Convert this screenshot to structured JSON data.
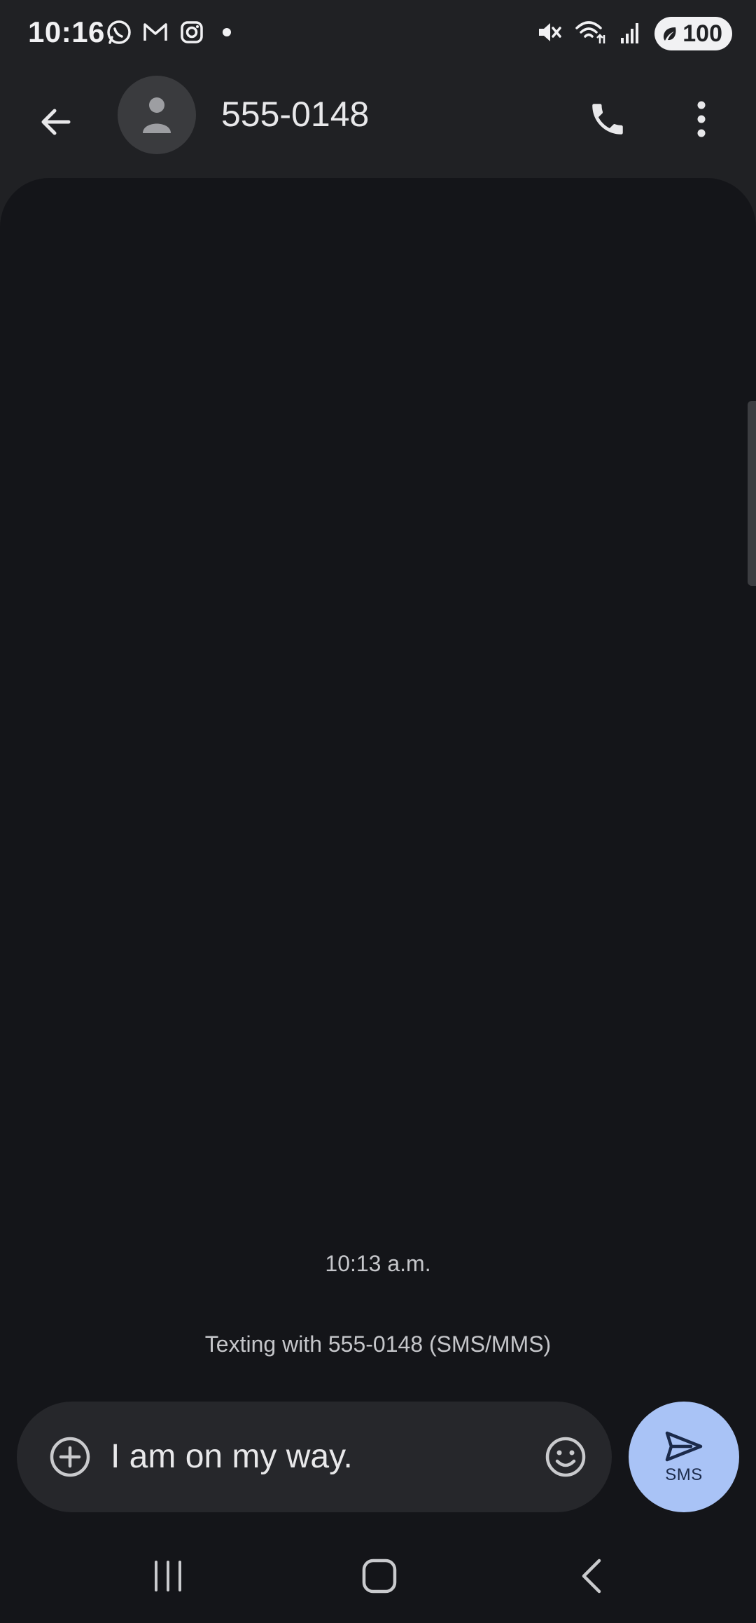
{
  "status_bar": {
    "time": "10:16",
    "notification_icons": [
      "whatsapp-icon",
      "gmail-icon",
      "instagram-icon",
      "dot-icon"
    ],
    "system_icons": [
      "mute-icon",
      "wifi-icon",
      "signal-icon"
    ],
    "battery": "100"
  },
  "header": {
    "contact_name": "555-0148",
    "icons": {
      "back": "arrow-left-icon",
      "avatar": "person-icon",
      "call": "phone-icon",
      "more": "more-vertical-icon"
    }
  },
  "conversation": {
    "timestamp": "10:13 a.m.",
    "info": "Texting with 555-0148 (SMS/MMS)"
  },
  "compose": {
    "text": "I am on my way.",
    "send_label": "SMS",
    "icons": {
      "add": "add-circle-icon",
      "emoji": "emoji-icon",
      "send": "send-icon"
    }
  },
  "navigation": {
    "icons": [
      "recent-apps-icon",
      "home-icon",
      "back-icon"
    ]
  },
  "colors": {
    "background": "#141519",
    "app_bar": "#202124",
    "compose_box": "#26272b",
    "send_button": "#a9c3f6"
  }
}
